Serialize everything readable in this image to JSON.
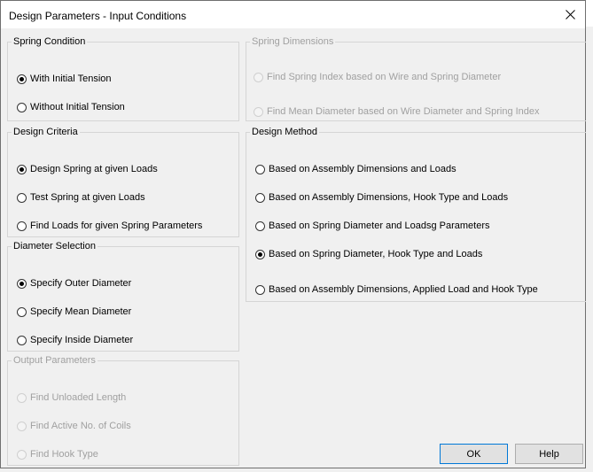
{
  "window": {
    "title": "Design Parameters - Input Conditions",
    "close_icon": "close-icon"
  },
  "groups": {
    "spring_condition": {
      "legend": "Spring Condition",
      "options": [
        {
          "label": "With Initial Tension",
          "selected": true
        },
        {
          "label": "Without Initial Tension",
          "selected": false
        }
      ]
    },
    "spring_dimensions": {
      "legend": "Spring Dimensions",
      "disabled": true,
      "options": [
        {
          "label": "Find Spring Index based on Wire and Spring Diameter",
          "selected": false
        },
        {
          "label": "Find Mean Diameter based on Wire Diameter and Spring Index",
          "selected": false
        }
      ]
    },
    "design_criteria": {
      "legend": "Design Criteria",
      "options": [
        {
          "label": "Design Spring at given Loads",
          "selected": true
        },
        {
          "label": "Test Spring at given Loads",
          "selected": false
        },
        {
          "label": "Find Loads for given Spring Parameters",
          "selected": false
        }
      ]
    },
    "design_method": {
      "legend": "Design Method",
      "options": [
        {
          "label": "Based on Assembly Dimensions and Loads",
          "selected": false
        },
        {
          "label": "Based on Assembly Dimensions, Hook Type and Loads",
          "selected": false
        },
        {
          "label": "Based on Spring Diameter and Loadsg Parameters",
          "selected": false
        },
        {
          "label": "Based on Spring Diameter, Hook Type and Loads",
          "selected": true
        },
        {
          "label": "Based on Assembly Dimensions, Applied Load and Hook Type",
          "selected": false
        }
      ]
    },
    "diameter_selection": {
      "legend": "Diameter Selection",
      "options": [
        {
          "label": "Specify Outer Diameter",
          "selected": true
        },
        {
          "label": "Specify Mean Diameter",
          "selected": false
        },
        {
          "label": "Specify Inside Diameter",
          "selected": false
        }
      ]
    },
    "output_parameters": {
      "legend": "Output Parameters",
      "disabled": true,
      "options": [
        {
          "label": "Find Unloaded Length",
          "selected": false
        },
        {
          "label": "Find Active No. of Coils",
          "selected": false
        },
        {
          "label": "Find Hook Type",
          "selected": false
        }
      ]
    }
  },
  "buttons": {
    "ok": "OK",
    "help": "Help"
  }
}
